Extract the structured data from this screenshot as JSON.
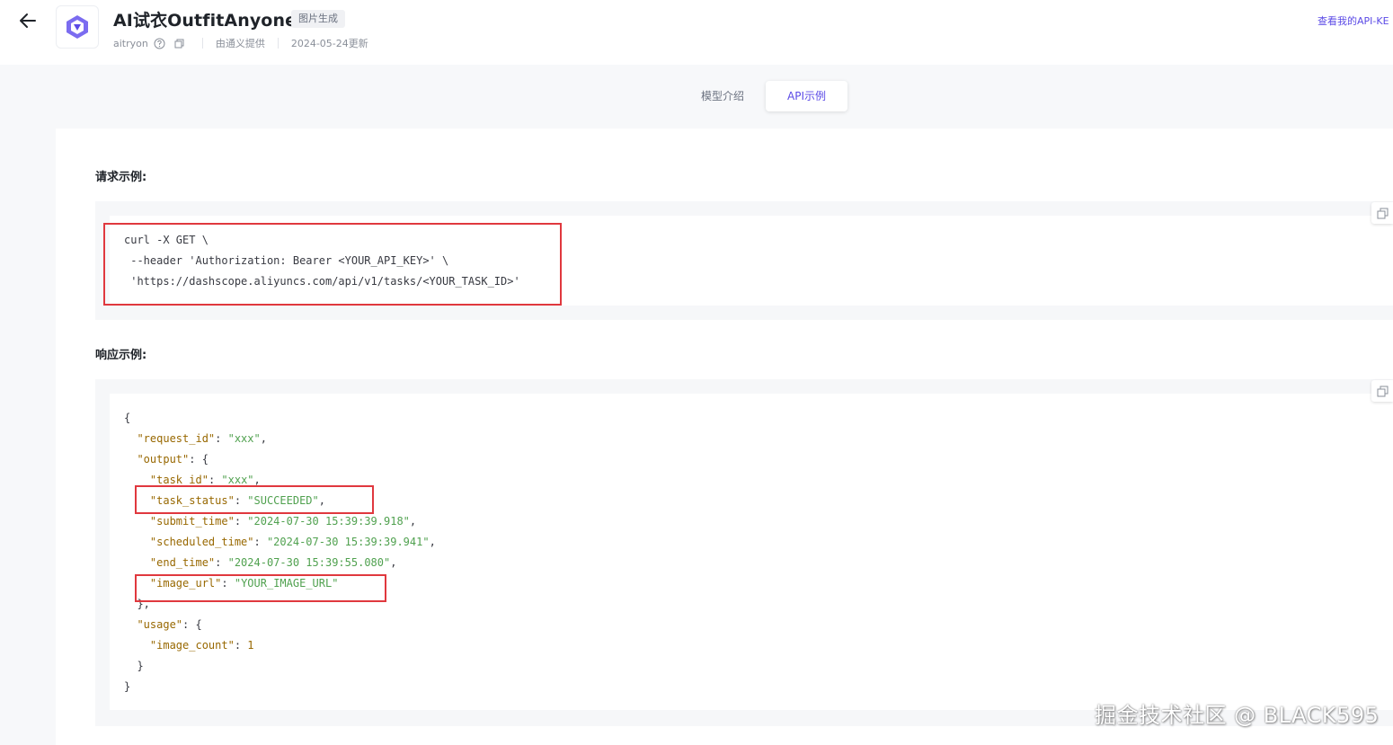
{
  "header": {
    "title": "AI试衣OutfitAnyone",
    "tag": "图片生成",
    "model_id": "aitryon",
    "provider": "由通义提供",
    "updated": "2024-05-24更新",
    "api_key_link": "查看我的API-KE"
  },
  "tabs": [
    {
      "label": "模型介绍",
      "active": false
    },
    {
      "label": "API示例",
      "active": true
    }
  ],
  "request": {
    "title": "请求示例:",
    "lines": [
      "curl -X GET \\",
      " --header 'Authorization: Bearer <YOUR_API_KEY>' \\",
      " 'https://dashscope.aliyuncs.com/api/v1/tasks/<YOUR_TASK_ID>'"
    ]
  },
  "response": {
    "title": "响应示例:",
    "open_brace": "{",
    "request_id_key": "\"request_id\"",
    "request_id_val": "\"xxx\"",
    "output_key": "\"output\"",
    "task_id_key": "\"task_id\"",
    "task_id_val": "\"xxx\"",
    "task_status_key": "\"task_status\"",
    "task_status_val": "\"SUCCEEDED\"",
    "submit_time_key": "\"submit_time\"",
    "submit_time_val": "\"2024-07-30 15:39:39.918\"",
    "scheduled_time_key": "\"scheduled_time\"",
    "scheduled_time_val": "\"2024-07-30 15:39:39.941\"",
    "end_time_key": "\"end_time\"",
    "end_time_val": "\"2024-07-30 15:39:55.080\"",
    "image_url_key": "\"image_url\"",
    "image_url_val": "\"YOUR_IMAGE_URL\"",
    "usage_key": "\"usage\"",
    "image_count_key": "\"image_count\"",
    "image_count_val": "1",
    "close_brace": "}"
  },
  "watermark": "掘金技术社区 @ BLACK595",
  "icons": {
    "back": "arrow-left-icon",
    "logo": "qwen-logo-icon",
    "help": "question-circle-icon",
    "copy": "copy-icon"
  },
  "colors": {
    "accent": "#5b4ae6",
    "highlight_box": "#e0383e",
    "json_key": "#986801",
    "json_string": "#50a14f"
  }
}
